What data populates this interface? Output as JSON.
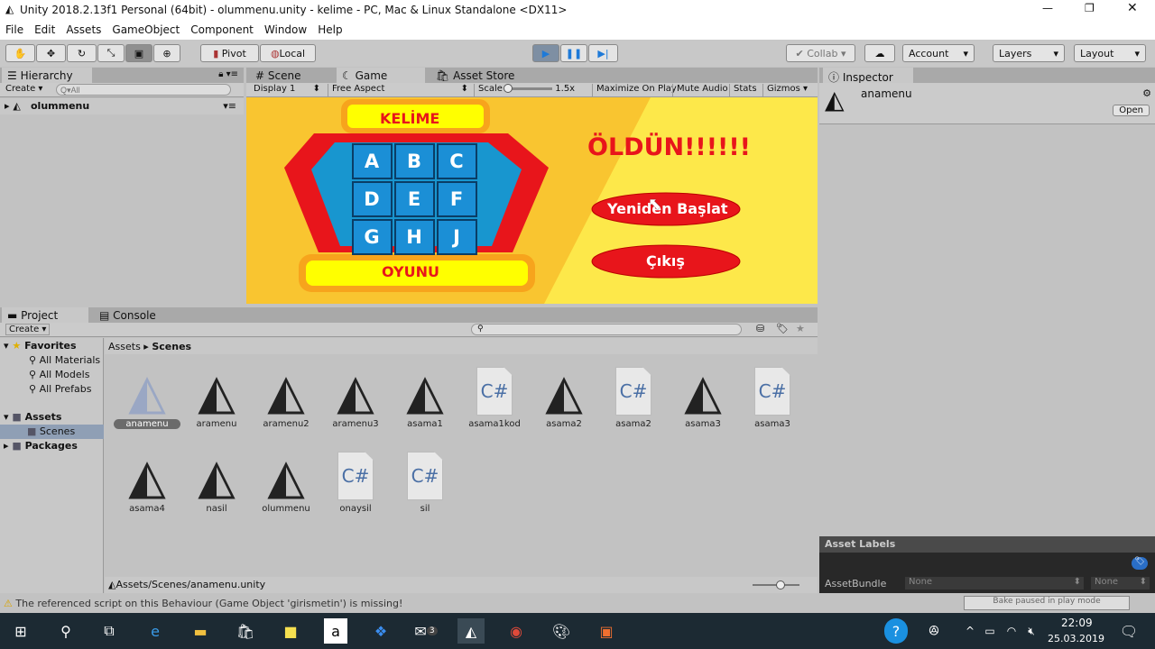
{
  "window": {
    "title": "Unity 2018.2.13f1 Personal (64bit) - olummenu.unity - kelime - PC, Mac & Linux Standalone <DX11>"
  },
  "menu": [
    "File",
    "Edit",
    "Assets",
    "GameObject",
    "Component",
    "Window",
    "Help"
  ],
  "toolbar": {
    "pivot": "Pivot",
    "local": "Local",
    "collab": "Collab",
    "account": "Account",
    "layers": "Layers",
    "layout": "Layout"
  },
  "hierarchy": {
    "tab": "Hierarchy",
    "create": "Create",
    "search_placeholder": "Q▾All",
    "scene": "olummenu"
  },
  "scene_tabs": {
    "scene": "Scene",
    "game": "Game",
    "asset_store": "Asset Store"
  },
  "game_bar": {
    "display": "Display 1",
    "aspect": "Free Aspect",
    "scale_label": "Scale",
    "scale_value": "1.5x",
    "maximize": "Maximize On Play",
    "mute": "Mute Audio",
    "stats": "Stats",
    "gizmos": "Gizmos"
  },
  "game": {
    "top_banner": "KELİME",
    "bottom_banner": "OYUNU",
    "letters": [
      "A",
      "B",
      "C",
      "D",
      "E",
      "F",
      "G",
      "H",
      "J"
    ],
    "title": "ÖLDÜN!!!!!!",
    "restart": "Yeniden Başlat",
    "exit": "Çıkış",
    "colors": {
      "bg": "#f9c530",
      "bg_right": "#fde84a",
      "red": "#e8151b",
      "blue": "#1b8fd6",
      "yellow": "#ffff00"
    }
  },
  "inspector": {
    "tab": "Inspector",
    "name": "anamenu",
    "open": "Open",
    "asset_labels": "Asset Labels",
    "assetbundle_label": "AssetBundle",
    "bundle_value": "None",
    "variant_value": "None",
    "bake_status": "Bake paused in play mode"
  },
  "project": {
    "tab": "Project",
    "console_tab": "Console",
    "create": "Create",
    "favorites": {
      "label": "Favorites",
      "items": [
        "All Materials",
        "All Models",
        "All Prefabs"
      ]
    },
    "assets_label": "Assets",
    "scenes_label": "Scenes",
    "packages_label": "Packages",
    "breadcrumb": [
      "Assets",
      "Scenes"
    ],
    "files": [
      {
        "name": "anamenu",
        "type": "unity"
      },
      {
        "name": "aramenu",
        "type": "unity"
      },
      {
        "name": "aramenu2",
        "type": "unity"
      },
      {
        "name": "aramenu3",
        "type": "unity"
      },
      {
        "name": "asama1",
        "type": "unity"
      },
      {
        "name": "asama1kod",
        "type": "cs"
      },
      {
        "name": "asama2",
        "type": "unity"
      },
      {
        "name": "asama2",
        "type": "cs"
      },
      {
        "name": "asama3",
        "type": "unity"
      },
      {
        "name": "asama3",
        "type": "cs"
      },
      {
        "name": "asama4",
        "type": "unity"
      },
      {
        "name": "nasil",
        "type": "unity"
      },
      {
        "name": "olummenu",
        "type": "unity"
      },
      {
        "name": "onaysil",
        "type": "cs"
      },
      {
        "name": "sil",
        "type": "cs"
      }
    ],
    "path": "Assets/Scenes/anamenu.unity"
  },
  "status": "The referenced script on this Behaviour (Game Object 'girismetin') is missing!",
  "taskbar": {
    "time": "22:09",
    "date": "25.03.2019",
    "badge": "3"
  }
}
